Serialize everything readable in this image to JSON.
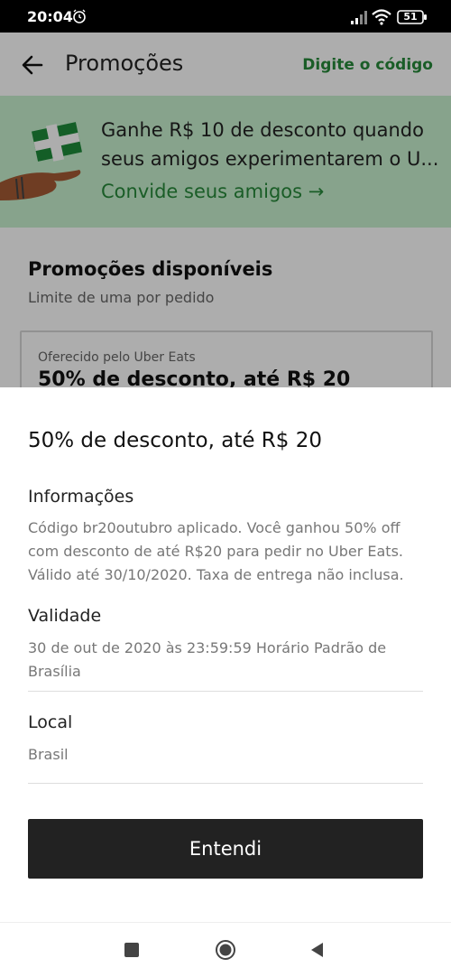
{
  "status_bar": {
    "time": "20:04",
    "battery": "51"
  },
  "app_bar": {
    "title": "Promoções",
    "code_link": "Digite o código"
  },
  "referral": {
    "text": "Ganhe R$ 10 de desconto quando seus amigos experimentarem o U...",
    "link": "Convide seus amigos →"
  },
  "promotions": {
    "title": "Promoções disponíveis",
    "subtitle": "Limite de uma por pedido",
    "card_label": "Oferecido pelo Uber Eats",
    "card_title": "50% de desconto, até R$ 20"
  },
  "sheet": {
    "title": "50% de desconto, até R$ 20",
    "info_heading": "Informações",
    "info_body": "Código br20outubro aplicado. Você ganhou 50% off com desconto de até R$20 para pedir no Uber Eats. Válido até 30/10/2020. Taxa de entrega não inclusa.",
    "validity_heading": "Validade",
    "validity_body": "30 de out de 2020 às 23:59:59 Horário Padrão de Brasília",
    "local_heading": "Local",
    "local_body": "Brasil",
    "button_label": "Entendi"
  },
  "colors": {
    "accent_green": "#278a3a",
    "banner_green": "#c7f0cf",
    "button_dark": "#222222"
  },
  "icons": {
    "back": "arrow-left-icon",
    "alarm": "alarm-clock-icon",
    "signal": "cell-signal-icon",
    "wifi": "wifi-icon",
    "battery": "battery-icon",
    "nav_recent": "square-icon",
    "nav_home": "circle-icon",
    "nav_back": "triangle-back-icon"
  }
}
